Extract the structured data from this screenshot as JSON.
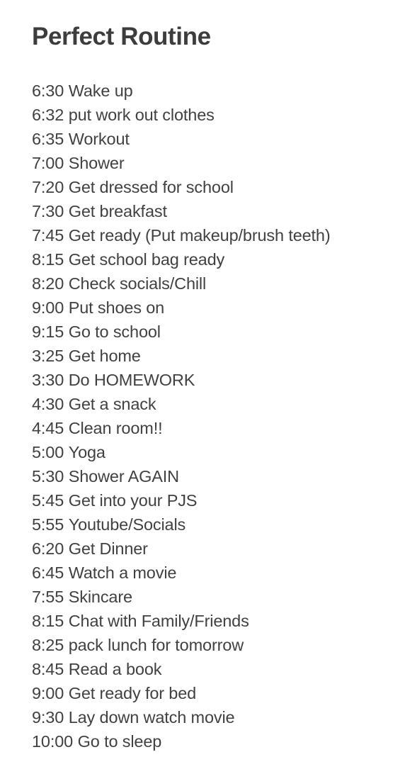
{
  "document": {
    "title": "Perfect Routine",
    "background_color": "#ffffff",
    "title_color": "#3d3d3d",
    "text_color": "#414141",
    "items": [
      {
        "time": "6:30",
        "activity": "Wake up"
      },
      {
        "time": "6:32",
        "activity": "put work out clothes"
      },
      {
        "time": "6:35",
        "activity": "Workout"
      },
      {
        "time": "7:00",
        "activity": "Shower"
      },
      {
        "time": "7:20",
        "activity": "Get dressed for school"
      },
      {
        "time": "7:30",
        "activity": "Get breakfast"
      },
      {
        "time": "7:45",
        "activity": "Get ready (Put makeup/brush teeth)"
      },
      {
        "time": "8:15",
        "activity": "Get school bag ready"
      },
      {
        "time": "8:20",
        "activity": "Check socials/Chill"
      },
      {
        "time": "9:00",
        "activity": "Put shoes on"
      },
      {
        "time": "9:15",
        "activity": "Go to school"
      },
      {
        "time": "3:25",
        "activity": "Get home"
      },
      {
        "time": "3:30",
        "activity": "Do HOMEWORK"
      },
      {
        "time": "4:30",
        "activity": "Get a snack"
      },
      {
        "time": "4:45",
        "activity": "Clean room!!"
      },
      {
        "time": "5:00",
        "activity": "Yoga"
      },
      {
        "time": "5:30",
        "activity": "Shower AGAIN"
      },
      {
        "time": "5:45",
        "activity": "Get into your PJS"
      },
      {
        "time": "5:55",
        "activity": "Youtube/Socials"
      },
      {
        "time": "6:20",
        "activity": "Get Dinner"
      },
      {
        "time": "6:45",
        "activity": "Watch a movie"
      },
      {
        "time": "7:55",
        "activity": "Skincare"
      },
      {
        "time": "8:15",
        "activity": "Chat with Family/Friends"
      },
      {
        "time": "8:25",
        "activity": "pack lunch for tomorrow"
      },
      {
        "time": "8:45",
        "activity": "Read a book"
      },
      {
        "time": "9:00",
        "activity": "Get ready for bed"
      },
      {
        "time": "9:30",
        "activity": "Lay down watch movie"
      },
      {
        "time": "10:00",
        "activity": "Go to sleep"
      }
    ]
  }
}
